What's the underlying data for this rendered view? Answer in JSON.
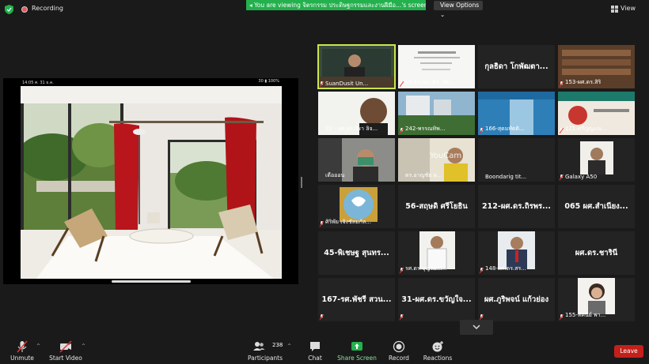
{
  "top": {
    "recording": "Recording",
    "banner": "You are viewing จิตรกรรม ประดิษฐกรรมและงานฝีมือ...'s screen",
    "view_options": "View Options",
    "view": "View"
  },
  "share": {
    "time": "14:05  ศ. 31 ธ.ค.",
    "status": "30  ▮  100%"
  },
  "tiles": [
    {
      "name": "SuanDusit Un...",
      "big": ""
    },
    {
      "name": "ผศ.ดร.ณก.ดร. สต...",
      "big": ""
    },
    {
      "name": "",
      "big": "กุลธิดา โกพัฒตา..."
    },
    {
      "name": "153-ผศ.ดร.สิริ",
      "big": ""
    },
    {
      "name": "02 - ผศ.ดร.จิรา ลิจ...",
      "big": ""
    },
    {
      "name": "242-พรรณทิพ...",
      "big": ""
    },
    {
      "name": "166-สุดมหัตติ...",
      "big": ""
    },
    {
      "name": "121-ศรีญญะณ...",
      "big": ""
    },
    {
      "name": "เดือออน",
      "big": ""
    },
    {
      "name": "ดร.อาญชัย ผ...",
      "big": ""
    },
    {
      "name": "Boondarig tit...",
      "big": ""
    },
    {
      "name": "Galaxy A50",
      "big": ""
    },
    {
      "name": "ศิริพัย เจิงชัลมกัล...",
      "big": ""
    },
    {
      "name": "",
      "big": "56-สฤษดิ ศรีโยธิน"
    },
    {
      "name": "",
      "big": "212-ผศ.ดร.ถิรพร..."
    },
    {
      "name": "",
      "big": "065 ผศ.สำเนียง..."
    },
    {
      "name": "",
      "big": "45-พิเชษฐ สุนทร..."
    },
    {
      "name": "รศ.ดร.บุญรม...",
      "big": ""
    },
    {
      "name": "148-ผศ.ดร.สร...",
      "big": ""
    },
    {
      "name": "",
      "big": "ผศ.ดร.ชารินี"
    },
    {
      "name": "",
      "big": "167-รศ.พัชรี สวน..."
    },
    {
      "name": "",
      "big": "31-ผศ.ดร.ขวัญใจ..."
    },
    {
      "name": "",
      "big": "ผศ.ภูริพจน์ แก้วย่อง"
    },
    {
      "name": "155-ทัศนีย์ พา...",
      "big": ""
    }
  ],
  "watermark": "YouCam",
  "toolbar": {
    "unmute": "Unmute",
    "start_video": "Start Video",
    "participants": "Participants",
    "participant_count": "238",
    "chat": "Chat",
    "share_screen": "Share Screen",
    "record": "Record",
    "reactions": "Reactions",
    "leave": "Leave"
  },
  "colors": {
    "share_green": "#23b14d",
    "leave_red": "#c4201b",
    "active_speaker": "#c9e64a"
  }
}
